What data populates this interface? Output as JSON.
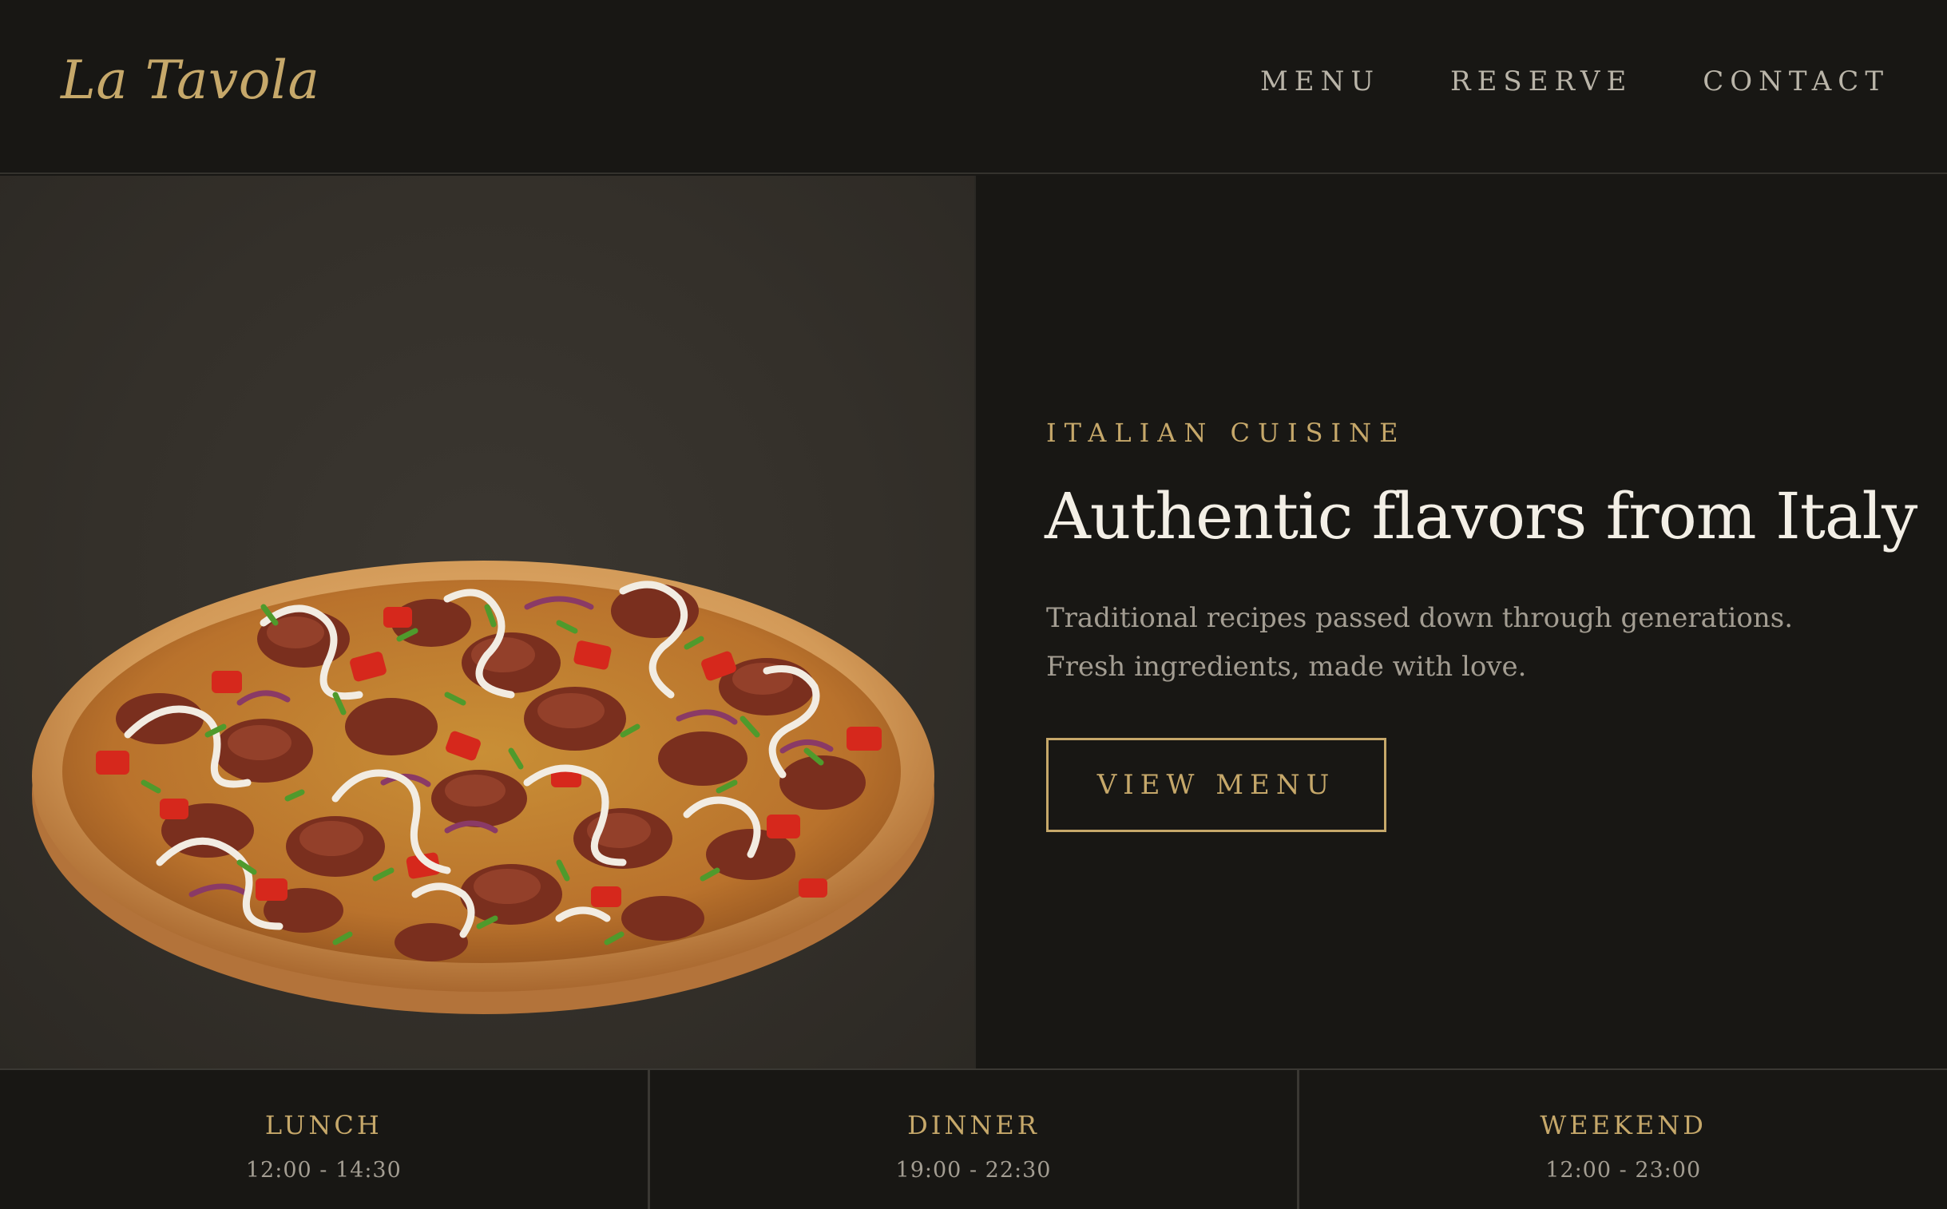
{
  "brand": {
    "logo": "La Tavola"
  },
  "nav": {
    "items": [
      {
        "label": "MENU"
      },
      {
        "label": "RESERVE"
      },
      {
        "label": "CONTACT"
      }
    ]
  },
  "hero": {
    "image": {
      "icon": "pizza-photo"
    },
    "eyebrow": "ITALIAN CUISINE",
    "title": "Authentic flavors from Italy",
    "text": "Traditional recipes passed down through generations. Fresh ingredients, made with love.",
    "cta_label": "VIEW MENU"
  },
  "hours": [
    {
      "label": "LUNCH",
      "time": "12:00 - 14:30"
    },
    {
      "label": "DINNER",
      "time": "19:00 - 22:30"
    },
    {
      "label": "WEEKEND",
      "time": "12:00 - 23:00"
    }
  ],
  "colors": {
    "accent": "#c6a86a",
    "background": "#181714",
    "image_panel": "#34302a",
    "heading": "#f3efe6",
    "muted_text": "#a39d92",
    "nav_text": "#b9b4a8"
  }
}
